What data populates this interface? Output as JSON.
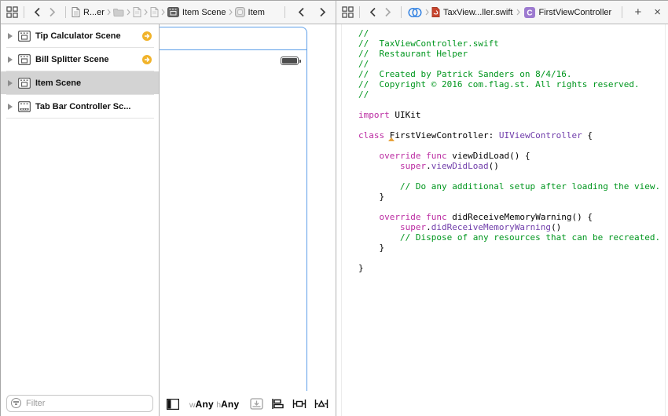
{
  "colors": {
    "selection_blue": "#5c9ee8",
    "warning_orange": "#f1b32a",
    "keyword_pink": "#bb2ca2",
    "comment_green": "#00961e",
    "type_purple": "#703daa",
    "swift_file_red": "#c8452e",
    "class_icon_purple": "#9d7ad0",
    "selected_row_gray": "#d3d3d3"
  },
  "left_jumpbar": {
    "breadcrumb": {
      "file_label": "R...er",
      "scene_label": "Item Scene",
      "item_label": "Item"
    }
  },
  "right_jumpbar": {
    "breadcrumb": {
      "file_label": "TaxView...ller.swift",
      "symbol_label": "FirstViewController"
    },
    "add_label": "+",
    "close_label": "×"
  },
  "outline": {
    "scenes": [
      {
        "label": "Tip Calculator Scene",
        "kind": "view-controller",
        "warning": true,
        "selected": false
      },
      {
        "label": "Bill Splitter Scene",
        "kind": "view-controller",
        "warning": true,
        "selected": false
      },
      {
        "label": "Item Scene",
        "kind": "view-controller",
        "warning": false,
        "selected": true
      },
      {
        "label": "Tab Bar Controller Sc...",
        "kind": "tab-bar-controller",
        "warning": false,
        "selected": false
      }
    ]
  },
  "filter": {
    "placeholder": "Filter"
  },
  "canvas_toolbar": {
    "size_classes": {
      "w_prefix": "w",
      "w_value": "Any",
      "h_prefix": "h",
      "h_value": "Any"
    }
  },
  "icons": [
    "related-items-icon",
    "back-chevron-icon",
    "forward-chevron-icon",
    "document-icon",
    "folder-icon",
    "view-controller-icon",
    "view-icon",
    "counterparts-icon",
    "swift-file-icon",
    "class-symbol-icon",
    "filter-icon",
    "warning-arrow-icon",
    "battery-icon",
    "document-outline-toggle-icon",
    "embed-stack-icon",
    "align-icon",
    "pin-icon",
    "resolve-autolayout-icon",
    "disclosure-triangle-icon"
  ],
  "code": {
    "lines": [
      {
        "tokens": [
          [
            "c",
            "//"
          ]
        ]
      },
      {
        "tokens": [
          [
            "c",
            "//  TaxViewController.swift"
          ]
        ]
      },
      {
        "tokens": [
          [
            "c",
            "//  Restaurant Helper"
          ]
        ]
      },
      {
        "tokens": [
          [
            "c",
            "//"
          ]
        ]
      },
      {
        "tokens": [
          [
            "c",
            "//  Created by Patrick Sanders on 8/4/16."
          ]
        ]
      },
      {
        "tokens": [
          [
            "c",
            "//  Copyright © 2016 com.flag.st. All rights reserved."
          ]
        ]
      },
      {
        "tokens": [
          [
            "c",
            "//"
          ]
        ]
      },
      {
        "tokens": []
      },
      {
        "tokens": [
          [
            "k",
            "import"
          ],
          [
            "p",
            " UIKit"
          ]
        ]
      },
      {
        "tokens": []
      },
      {
        "tokens": [
          [
            "k",
            "class"
          ],
          [
            "p",
            " FirstViewController: "
          ],
          [
            "t",
            "UIViewController"
          ],
          [
            "p",
            " {"
          ]
        ]
      },
      {
        "tokens": []
      },
      {
        "tokens": [
          [
            "p",
            "    "
          ],
          [
            "k",
            "override"
          ],
          [
            "p",
            " "
          ],
          [
            "k",
            "func"
          ],
          [
            "p",
            " viewDidLoad() {"
          ]
        ]
      },
      {
        "tokens": [
          [
            "p",
            "        "
          ],
          [
            "k",
            "super"
          ],
          [
            "p",
            "."
          ],
          [
            "t",
            "viewDidLoad"
          ],
          [
            "p",
            "()"
          ]
        ]
      },
      {
        "tokens": []
      },
      {
        "tokens": [
          [
            "p",
            "        "
          ],
          [
            "c",
            "// Do any additional setup after loading the view."
          ]
        ]
      },
      {
        "tokens": [
          [
            "p",
            "    }"
          ]
        ]
      },
      {
        "tokens": []
      },
      {
        "tokens": [
          [
            "p",
            "    "
          ],
          [
            "k",
            "override"
          ],
          [
            "p",
            " "
          ],
          [
            "k",
            "func"
          ],
          [
            "p",
            " didReceiveMemoryWarning() {"
          ]
        ]
      },
      {
        "tokens": [
          [
            "p",
            "        "
          ],
          [
            "k",
            "super"
          ],
          [
            "p",
            "."
          ],
          [
            "t",
            "didReceiveMemoryWarning"
          ],
          [
            "p",
            "()"
          ]
        ]
      },
      {
        "tokens": [
          [
            "p",
            "        "
          ],
          [
            "c",
            "// Dispose of any resources that can be recreated."
          ]
        ]
      },
      {
        "tokens": [
          [
            "p",
            "    }"
          ]
        ]
      },
      {
        "tokens": []
      },
      {
        "tokens": [
          [
            "p",
            "}"
          ]
        ]
      }
    ]
  }
}
